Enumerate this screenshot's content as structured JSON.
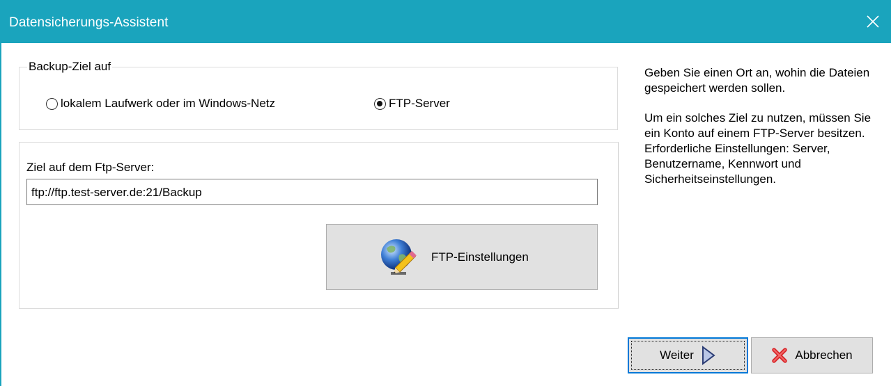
{
  "window": {
    "title": "Datensicherungs-Assistent",
    "close_icon": "close-icon"
  },
  "backup_target": {
    "legend": "Backup-Ziel auf",
    "options": [
      {
        "label": "lokalem Laufwerk oder im Windows-Netz",
        "checked": false
      },
      {
        "label": "FTP-Server",
        "checked": true
      }
    ]
  },
  "ftp": {
    "label": "Ziel auf dem Ftp-Server:",
    "path_value": "ftp://ftp.test-server.de:21/Backup",
    "settings_button": {
      "label": "FTP-Einstellungen",
      "icon": "globe-pencil-icon"
    }
  },
  "help": {
    "paragraphs": [
      "Geben Sie einen Ort an, wohin die Dateien gespeichert werden sollen.",
      "Um ein solches Ziel zu nutzen, müssen Sie ein Konto auf einem FTP-Server besitzen. Erforderliche Einstellungen: Server, Benutzername, Kennwort und Sicherheitseinstellungen."
    ]
  },
  "buttons": {
    "next": {
      "label": "Weiter",
      "icon": "play-arrow-icon"
    },
    "cancel": {
      "label": "Abbrechen",
      "icon": "red-x-icon"
    }
  },
  "colors": {
    "titlebar": "#1aa4bd",
    "focus_border": "#0078d7"
  }
}
